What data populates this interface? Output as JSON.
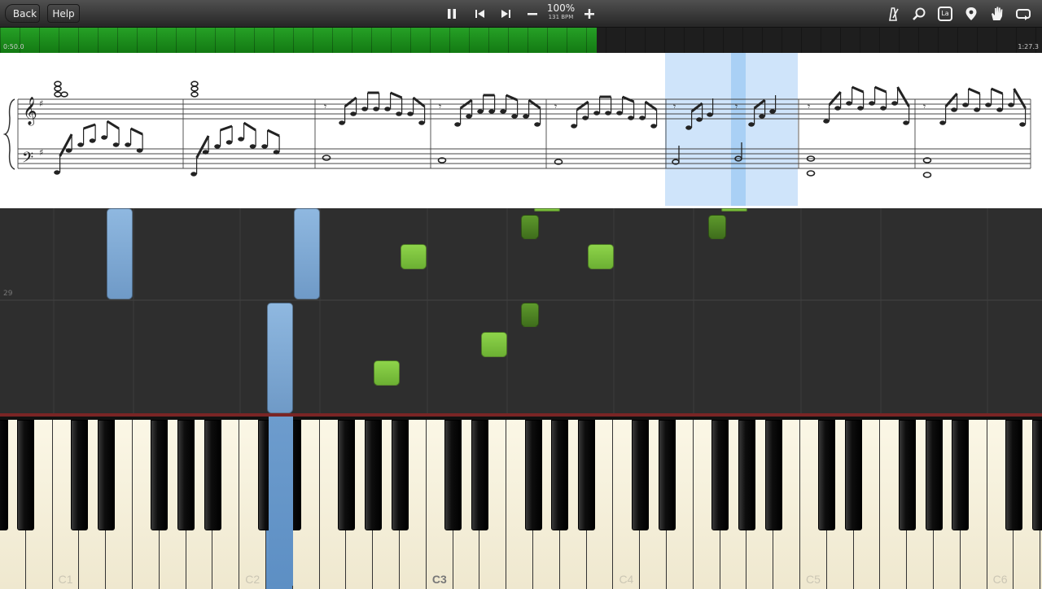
{
  "toolbar": {
    "back_label": "Back",
    "help_label": "Help",
    "zoom": "100%",
    "bpm": "131 BPM",
    "key_label_icon_text": "La",
    "icons": [
      "pause-icon",
      "skip-back-icon",
      "skip-forward-icon",
      "minus-icon",
      "plus-icon",
      "metronome-icon",
      "magnifier-icon",
      "key-label-icon",
      "location-pin-icon",
      "hand-icon",
      "loop-icon"
    ]
  },
  "progress": {
    "elapsed": "0:50.0",
    "total": "1:27.3",
    "fraction": 0.573,
    "color": "#1e9a1e"
  },
  "sheet": {
    "highlight_color": "#cfe4fa"
  },
  "roll": {
    "measure_number": "29",
    "left_hand_color": "#8fb8e0",
    "right_hand_color": "#8ed44a"
  },
  "keyboard": {
    "labels": [
      "C1",
      "C2",
      "C3",
      "C4",
      "C5",
      "C6"
    ],
    "active_keys": [
      "D2"
    ]
  }
}
